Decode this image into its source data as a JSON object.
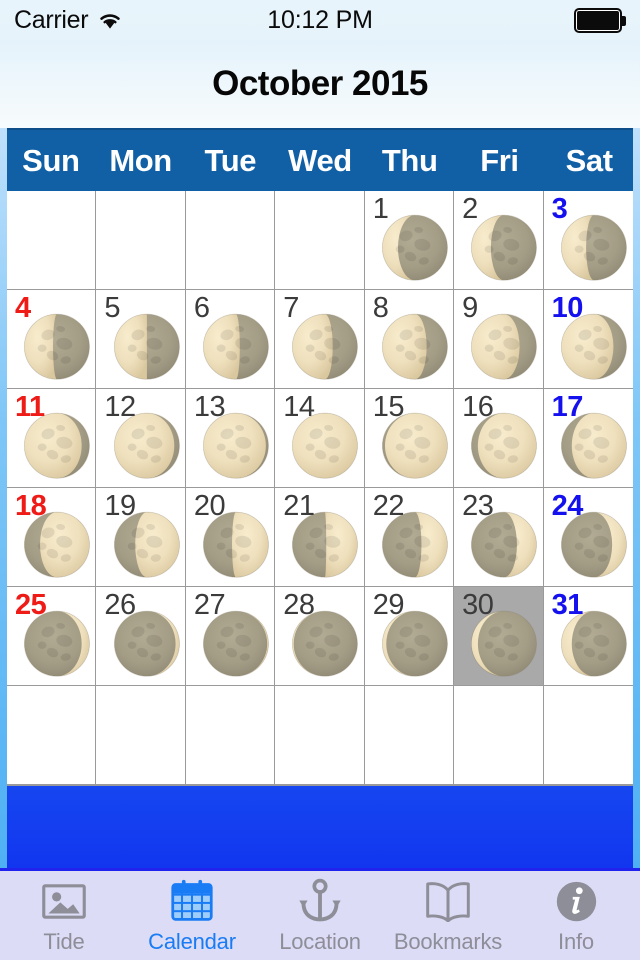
{
  "status_bar": {
    "carrier": "Carrier",
    "wifi_icon": "wifi-icon",
    "time": "10:12 PM",
    "battery_icon": "battery-full-icon"
  },
  "header": {
    "title": "October 2015"
  },
  "calendar": {
    "day_headers": [
      "Sun",
      "Mon",
      "Tue",
      "Wed",
      "Thu",
      "Fri",
      "Sat"
    ],
    "header_bg": "#1160a5",
    "sunday_color": "#ef1b17",
    "saturday_color": "#1510ee",
    "weekday_color": "#3b3b3b",
    "selected_bg": "#a9a9a9",
    "selected_day": 30,
    "cells": [
      {
        "day": "",
        "phase": null,
        "kind": "empty"
      },
      {
        "day": "",
        "phase": null,
        "kind": "empty"
      },
      {
        "day": "",
        "phase": null,
        "kind": "empty"
      },
      {
        "day": "",
        "phase": null,
        "kind": "empty"
      },
      {
        "day": "1",
        "phase": 0.62,
        "kind": "weekday"
      },
      {
        "day": "2",
        "phase": 0.65,
        "kind": "weekday"
      },
      {
        "day": "3",
        "phase": 0.69,
        "kind": "saturday"
      },
      {
        "day": "4",
        "phase": 0.72,
        "kind": "sunday"
      },
      {
        "day": "5",
        "phase": 0.75,
        "kind": "weekday"
      },
      {
        "day": "6",
        "phase": 0.78,
        "kind": "weekday"
      },
      {
        "day": "7",
        "phase": 0.81,
        "kind": "weekday"
      },
      {
        "day": "8",
        "phase": 0.84,
        "kind": "weekday"
      },
      {
        "day": "9",
        "phase": 0.87,
        "kind": "weekday"
      },
      {
        "day": "10",
        "phase": 0.9,
        "kind": "saturday"
      },
      {
        "day": "11",
        "phase": 0.94,
        "kind": "sunday"
      },
      {
        "day": "12",
        "phase": 0.96,
        "kind": "weekday"
      },
      {
        "day": "13",
        "phase": 0.98,
        "kind": "weekday"
      },
      {
        "day": "14",
        "phase": 0.0,
        "kind": "weekday"
      },
      {
        "day": "15",
        "phase": 0.02,
        "kind": "weekday"
      },
      {
        "day": "16",
        "phase": 0.05,
        "kind": "weekday"
      },
      {
        "day": "17",
        "phase": 0.08,
        "kind": "saturday"
      },
      {
        "day": "18",
        "phase": 0.12,
        "kind": "sunday"
      },
      {
        "day": "19",
        "phase": 0.16,
        "kind": "weekday"
      },
      {
        "day": "20",
        "phase": 0.22,
        "kind": "weekday"
      },
      {
        "day": "21",
        "phase": 0.26,
        "kind": "weekday"
      },
      {
        "day": "22",
        "phase": 0.3,
        "kind": "weekday"
      },
      {
        "day": "23",
        "phase": 0.35,
        "kind": "weekday"
      },
      {
        "day": "24",
        "phase": 0.39,
        "kind": "saturday"
      },
      {
        "day": "25",
        "phase": 0.44,
        "kind": "sunday"
      },
      {
        "day": "26",
        "phase": 0.47,
        "kind": "weekday"
      },
      {
        "day": "27",
        "phase": 0.49,
        "kind": "weekday"
      },
      {
        "day": "28",
        "phase": 0.51,
        "kind": "weekday"
      },
      {
        "day": "29",
        "phase": 0.53,
        "kind": "weekday"
      },
      {
        "day": "30",
        "phase": 0.55,
        "kind": "weekday",
        "selected": true
      },
      {
        "day": "31",
        "phase": 0.58,
        "kind": "saturday"
      },
      {
        "day": "",
        "phase": null,
        "kind": "empty"
      },
      {
        "day": "",
        "phase": null,
        "kind": "empty"
      },
      {
        "day": "",
        "phase": null,
        "kind": "empty"
      },
      {
        "day": "",
        "phase": null,
        "kind": "empty"
      },
      {
        "day": "",
        "phase": null,
        "kind": "empty"
      },
      {
        "day": "",
        "phase": null,
        "kind": "empty"
      },
      {
        "day": "",
        "phase": null,
        "kind": "empty"
      }
    ]
  },
  "tabbar": {
    "active_index": 1,
    "active_color": "#1a7cf5",
    "inactive_color": "#8e8e99",
    "items": [
      {
        "label": "Tide",
        "icon": "photo-image-icon"
      },
      {
        "label": "Calendar",
        "icon": "calendar-icon"
      },
      {
        "label": "Location",
        "icon": "anchor-icon"
      },
      {
        "label": "Bookmarks",
        "icon": "open-book-icon"
      },
      {
        "label": "Info",
        "icon": "info-circle-icon"
      }
    ]
  }
}
